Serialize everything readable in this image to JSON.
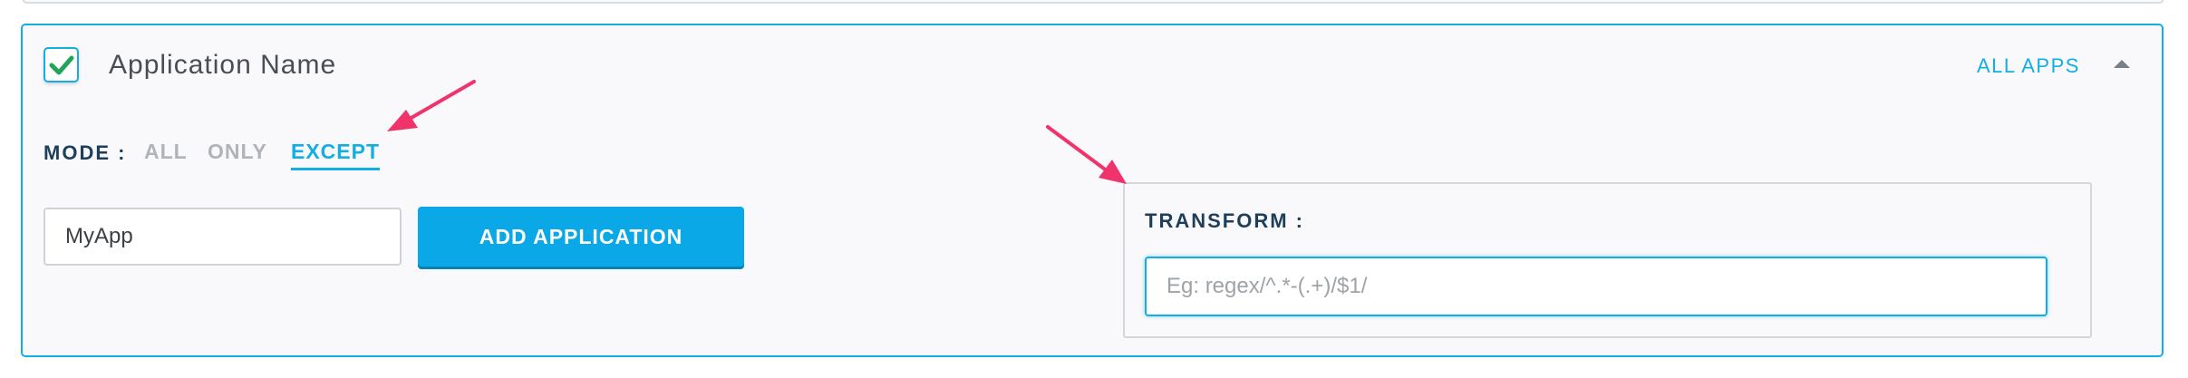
{
  "section": {
    "title": "Application Name",
    "enabled": true,
    "scope_link": "ALL APPS",
    "collapse_icon": "caret-up-icon"
  },
  "mode": {
    "label": "MODE :",
    "options": [
      "ALL",
      "ONLY",
      "EXCEPT"
    ],
    "selected": "EXCEPT"
  },
  "application": {
    "input_value": "MyApp",
    "add_button_label": "ADD APPLICATION"
  },
  "transform": {
    "label": "TRANSFORM :",
    "placeholder": "Eg: regex/^.*-(.+)/$1/",
    "value": ""
  },
  "colors": {
    "accent": "#13aee3",
    "button": "#0aa8e6",
    "label": "#1d3f5a",
    "annotation_arrow": "#f0336b"
  }
}
